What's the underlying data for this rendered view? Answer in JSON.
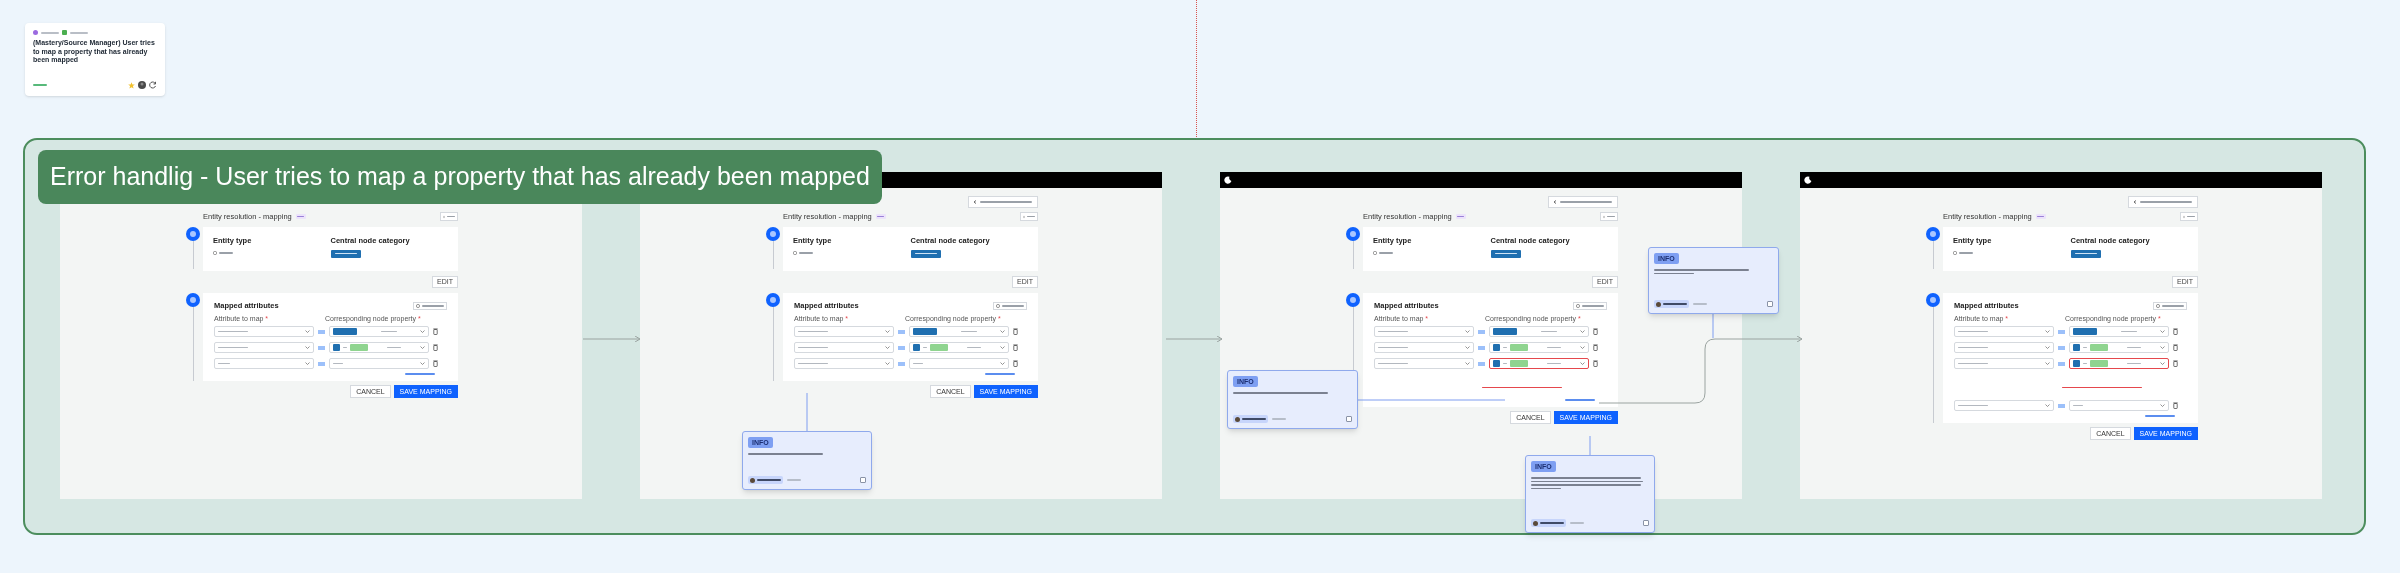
{
  "board_card": {
    "title": "(Mastery/Source Manager) User tries to map a property that has already been mapped"
  },
  "section": {
    "title": "Error handlig - User tries to map a property that has already been mapped"
  },
  "frames": [
    {
      "top_bar": false,
      "back_button": false,
      "title": "Entity resolution - mapping",
      "entity_type_label": "Entity type",
      "category_label": "Central node category",
      "edit": "EDIT",
      "attributes_title": "Mapped attributes",
      "column_labels": [
        {
          "text": "Attribute to map",
          "mark": "*"
        },
        {
          "text": "Corresponding node property",
          "mark": "*"
        }
      ],
      "rows": [
        {
          "kind": "tag",
          "error": false
        },
        {
          "kind": "path",
          "error": false
        },
        {
          "kind": "empty",
          "error": false
        }
      ],
      "cancel": "CANCEL",
      "save": "SAVE MAPPING"
    },
    {
      "top_bar": true,
      "back_button": true,
      "title": "Entity resolution - mapping",
      "entity_type_label": "Entity type",
      "category_label": "Central node category",
      "edit": "EDIT",
      "attributes_title": "Mapped attributes",
      "column_labels": [
        {
          "text": "Attribute to map",
          "mark": "*"
        },
        {
          "text": "Corresponding node property",
          "mark": "*"
        }
      ],
      "rows": [
        {
          "kind": "tag",
          "error": false
        },
        {
          "kind": "path",
          "error": false
        },
        {
          "kind": "empty",
          "error": false
        }
      ],
      "cancel": "CANCEL",
      "save": "SAVE MAPPING"
    },
    {
      "top_bar": true,
      "logo": true,
      "back_button": true,
      "title": "Entity resolution - mapping",
      "entity_type_label": "Entity type",
      "category_label": "Central node category",
      "edit": "EDIT",
      "attributes_title": "Mapped attributes",
      "column_labels": [
        {
          "text": "Attribute to map",
          "mark": "*"
        },
        {
          "text": "Corresponding node property",
          "mark": "*"
        }
      ],
      "rows": [
        {
          "kind": "tag",
          "error": false
        },
        {
          "kind": "path",
          "error": false
        },
        {
          "kind": "path",
          "error": true
        }
      ],
      "cancel": "CANCEL",
      "save": "SAVE MAPPING"
    },
    {
      "top_bar": true,
      "logo": true,
      "back_button": true,
      "title": "Entity resolution - mapping",
      "entity_type_label": "Entity type",
      "category_label": "Central node category",
      "edit": "EDIT",
      "attributes_title": "Mapped attributes",
      "column_labels": [
        {
          "text": "Attribute to map",
          "mark": "*"
        },
        {
          "text": "Corresponding node property",
          "mark": "*"
        }
      ],
      "rows": [
        {
          "kind": "tag",
          "error": false
        },
        {
          "kind": "path",
          "error": false
        },
        {
          "kind": "path",
          "error": true
        },
        {
          "kind": "empty",
          "error": false
        }
      ],
      "cancel": "CANCEL",
      "save": "SAVE MAPPING"
    }
  ],
  "notes": [
    {
      "label": "INFO",
      "checked": false
    },
    {
      "label": "INFO",
      "checked": false
    },
    {
      "label": "INFO",
      "checked": false
    },
    {
      "label": "INFO",
      "checked": false
    }
  ]
}
